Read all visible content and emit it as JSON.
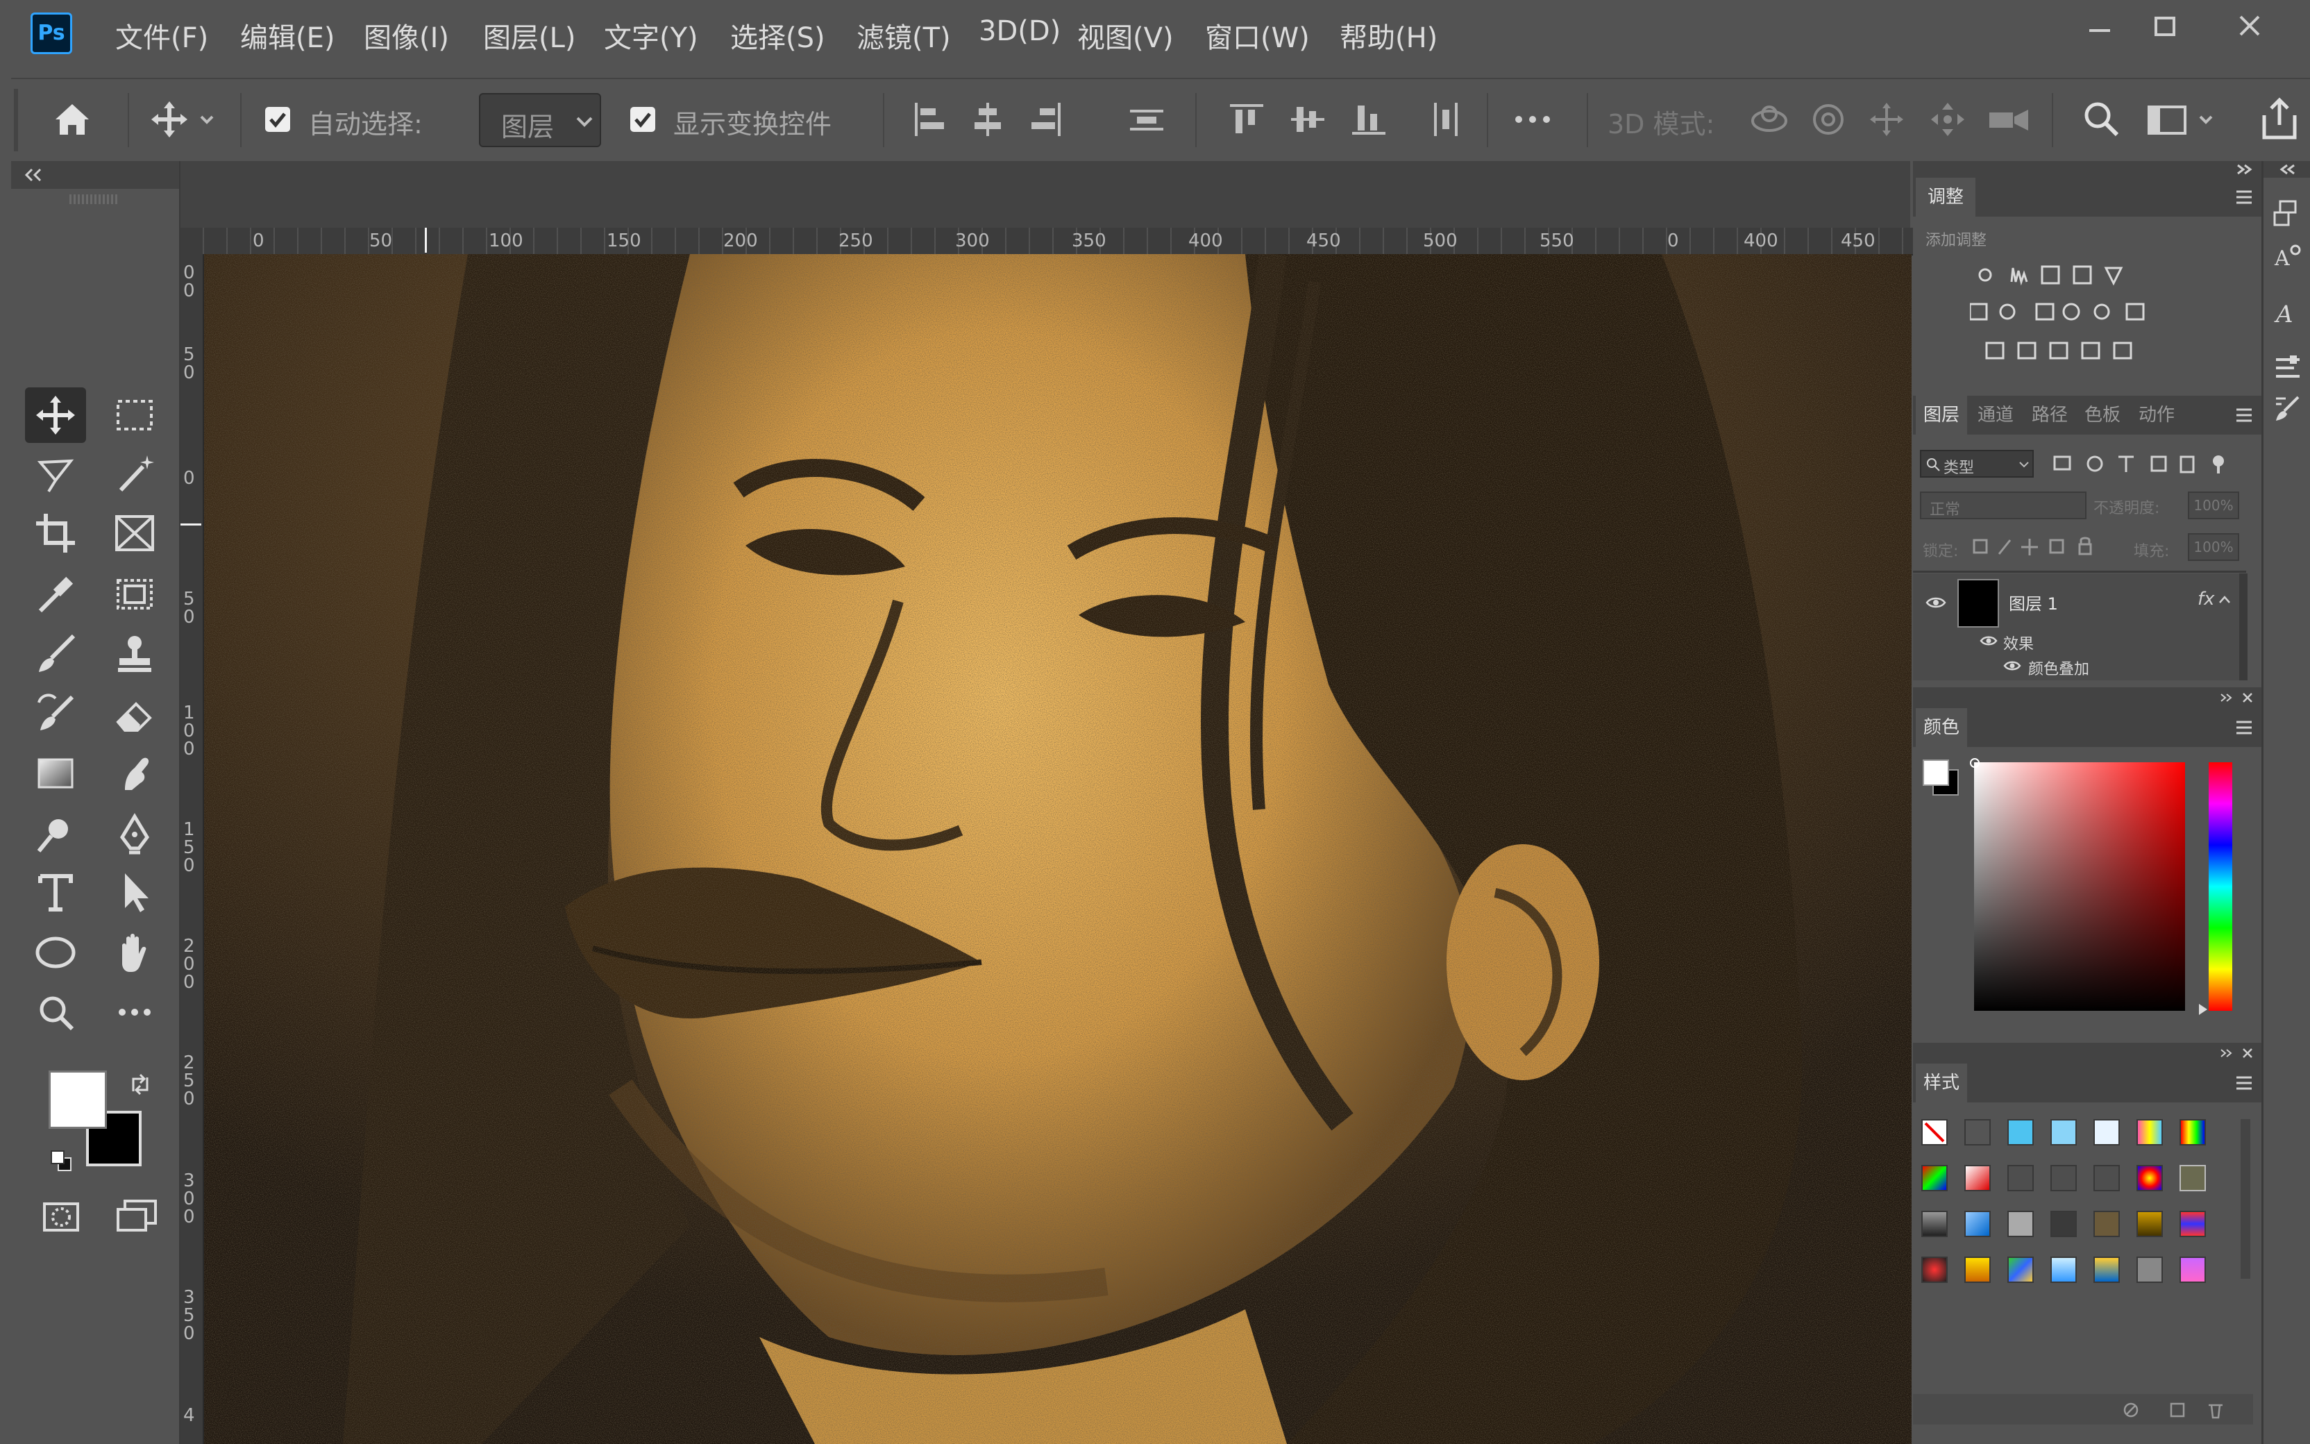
{
  "app": {
    "logo": "Ps",
    "name": "Adobe Photoshop"
  },
  "menu": [
    "文件(F)",
    "编辑(E)",
    "图像(I)",
    "图层(L)",
    "文字(Y)",
    "选择(S)",
    "滤镜(T)",
    "3D(D)",
    "视图(V)",
    "窗口(W)",
    "帮助(H)"
  ],
  "options_bar": {
    "auto_select_label": "自动选择:",
    "auto_select_checked": true,
    "auto_select_target": "图层",
    "show_transform_label": "显示变换控件",
    "show_transform_checked": true,
    "mode_3d_label": "3D 模式:"
  },
  "rulers": {
    "top": [
      "0",
      "50",
      "100",
      "150",
      "200",
      "250",
      "300",
      "350",
      "400",
      "450",
      "500",
      "550",
      "0",
      "400",
      "450"
    ],
    "left": [
      "0\n0",
      "5\n0",
      "0",
      "5\n0",
      "1\n0\n0",
      "1\n5\n0",
      "2\n0\n0",
      "2\n5\n0",
      "3\n0\n0",
      "3\n5\n0",
      "4"
    ]
  },
  "adjustments_panel": {
    "tab": "调整",
    "add_label": "添加调整"
  },
  "layers_panel": {
    "tabs": [
      "图层",
      "通道",
      "路径",
      "色板",
      "动作"
    ],
    "filter_kind": "类型",
    "blend_mode": "正常",
    "opacity_label": "不透明度:",
    "opacity_value": "100%",
    "lock_label": "锁定:",
    "fill_label": "填充:",
    "fill_value": "100%",
    "layer_name": "图层 1",
    "fx_badge": "fx",
    "effects_label": "效果",
    "effect_item": "颜色叠加"
  },
  "color_panel": {
    "tab": "颜色",
    "foreground": "#ffffff",
    "background": "#000000"
  },
  "styles_panel": {
    "tab": "样式"
  },
  "toolbox": {
    "foreground": "#ffffff",
    "background": "#000000"
  },
  "colors": {
    "ui_bg": "#535353",
    "ui_dark": "#434343",
    "canvas_gold": "#e0a850",
    "canvas_dark": "#221a10",
    "accent": "#31a8ff"
  }
}
